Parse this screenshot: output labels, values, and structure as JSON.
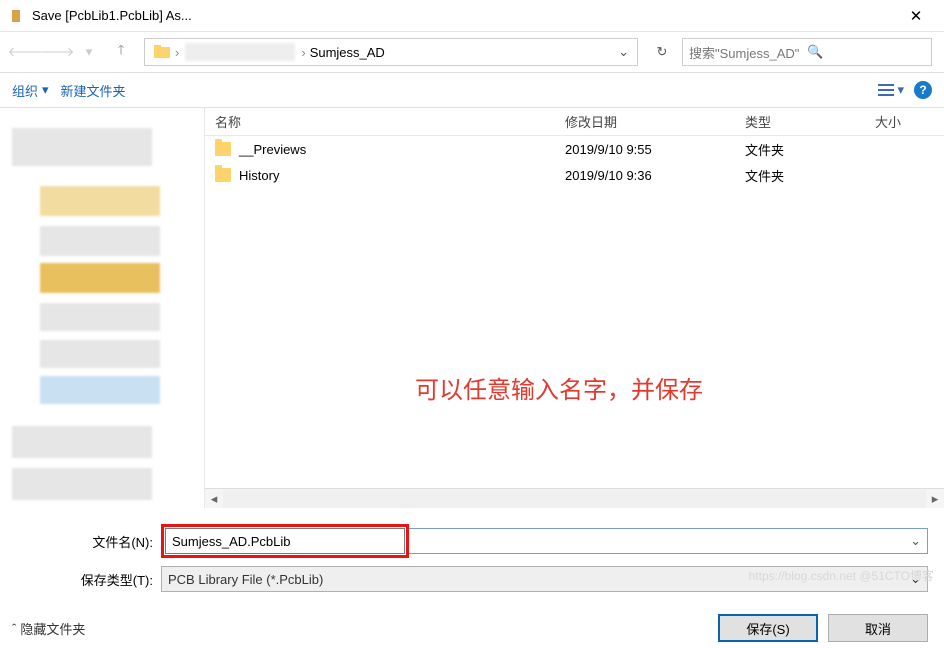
{
  "title": "Save [PcbLib1.PcbLib] As...",
  "nav": {
    "address": "Sumjess_AD",
    "search_placeholder": "搜索\"Sumjess_AD\""
  },
  "toolbar": {
    "organize": "组织",
    "new_folder": "新建文件夹"
  },
  "columns": {
    "name": "名称",
    "date": "修改日期",
    "type": "类型",
    "size": "大小"
  },
  "files": [
    {
      "name": "__Previews",
      "date": "2019/9/10 9:55",
      "type": "文件夹"
    },
    {
      "name": "History",
      "date": "2019/9/10 9:36",
      "type": "文件夹"
    }
  ],
  "annotation": "可以任意输入名字，并保存",
  "form": {
    "filename_label": "文件名(N):",
    "filename_value": "Sumjess_AD.PcbLib",
    "type_label": "保存类型(T):",
    "type_value": "PCB Library File (*.PcbLib)"
  },
  "footer": {
    "hide_folders": "隐藏文件夹",
    "save": "保存(S)",
    "cancel": "取消"
  },
  "watermark": "https://blog.csdn.net @51CTO博客"
}
